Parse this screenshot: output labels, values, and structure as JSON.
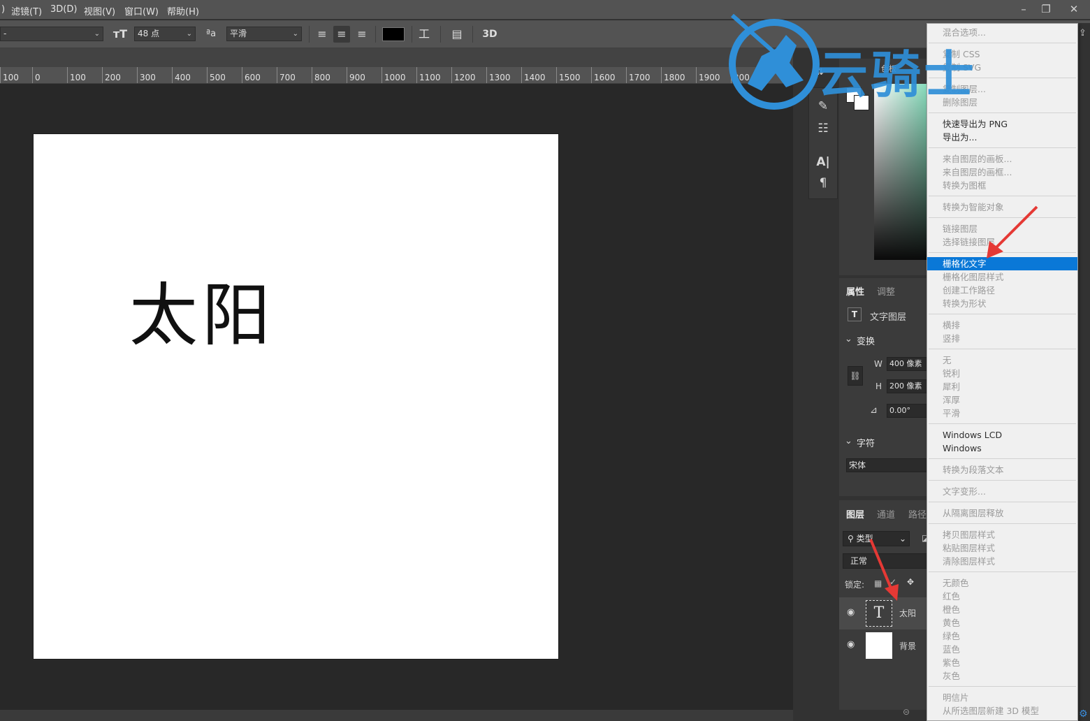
{
  "menubar": {
    "items": [
      "滤镜(T)",
      "3D(D)",
      "视图(V)",
      "窗口(W)",
      "帮助(H)"
    ],
    "left_fragment": ")",
    "window_buttons": [
      "minimize-icon",
      "restore-icon",
      "close-icon"
    ]
  },
  "optionsbar": {
    "font_style": "-",
    "size": "48 点",
    "antialias": "平滑",
    "three_d": "3D"
  },
  "ruler": {
    "labels": [
      "100",
      "0",
      "100",
      "200",
      "300",
      "400",
      "500",
      "600",
      "700",
      "800",
      "900",
      "1000",
      "1100",
      "1200",
      "1300",
      "1400",
      "1500",
      "1600",
      "1700",
      "1800",
      "1900",
      "200"
    ]
  },
  "document": {
    "text": "太阳",
    "background_color": "#ffffff"
  },
  "properties": {
    "tab_active": "属性",
    "tab_other": "调整",
    "layer_type": "文字图层",
    "transform_header": "变换",
    "w_label": "W",
    "w_value": "400 像素",
    "h_label": "H",
    "h_value": "200 像素",
    "angle_value": "0.00°",
    "char_header": "字符",
    "font_family": "宋体"
  },
  "layers": {
    "tabs": [
      "图层",
      "通道",
      "路径"
    ],
    "filter": "类型",
    "blend": "正常",
    "lock_label": "锁定:",
    "rows": [
      {
        "name": "太阳",
        "kind": "text"
      },
      {
        "name": "背景",
        "kind": "image"
      }
    ]
  },
  "color_panel": {
    "tab_fragment": "色板"
  },
  "context_menu": {
    "groups": [
      [
        {
          "label": "混合选项...",
          "enabled": false
        }
      ],
      [
        {
          "label": "复制 CSS",
          "enabled": false
        },
        {
          "label": "复制 SVG",
          "enabled": false
        }
      ],
      [
        {
          "label": "复制图层...",
          "enabled": false
        },
        {
          "label": "删除图层",
          "enabled": false
        }
      ],
      [
        {
          "label": "快速导出为 PNG",
          "enabled": true
        },
        {
          "label": "导出为...",
          "enabled": true
        }
      ],
      [
        {
          "label": "来自图层的画板...",
          "enabled": false
        },
        {
          "label": "来自图层的画框...",
          "enabled": false
        },
        {
          "label": "转换为图框",
          "enabled": false
        }
      ],
      [
        {
          "label": "转换为智能对象",
          "enabled": false
        }
      ],
      [
        {
          "label": "链接图层",
          "enabled": false
        },
        {
          "label": "选择链接图层",
          "enabled": false
        }
      ],
      [
        {
          "label": "栅格化文字",
          "enabled": true,
          "highlighted": true
        },
        {
          "label": "栅格化图层样式",
          "enabled": false
        },
        {
          "label": "创建工作路径",
          "enabled": false
        },
        {
          "label": "转换为形状",
          "enabled": false
        }
      ],
      [
        {
          "label": "横排",
          "enabled": false
        },
        {
          "label": "竖排",
          "enabled": false
        }
      ],
      [
        {
          "label": "无",
          "enabled": false
        },
        {
          "label": "锐利",
          "enabled": false
        },
        {
          "label": "犀利",
          "enabled": false
        },
        {
          "label": "浑厚",
          "enabled": false
        },
        {
          "label": "平滑",
          "enabled": false
        }
      ],
      [
        {
          "label": "Windows LCD",
          "enabled": true
        },
        {
          "label": "Windows",
          "enabled": true
        }
      ],
      [
        {
          "label": "转换为段落文本",
          "enabled": false
        }
      ],
      [
        {
          "label": "文字变形...",
          "enabled": false
        }
      ],
      [
        {
          "label": "从隔离图层释放",
          "enabled": false
        }
      ],
      [
        {
          "label": "拷贝图层样式",
          "enabled": false
        },
        {
          "label": "粘贴图层样式",
          "enabled": false
        },
        {
          "label": "清除图层样式",
          "enabled": false
        }
      ],
      [
        {
          "label": "无颜色",
          "enabled": false
        },
        {
          "label": "红色",
          "enabled": false
        },
        {
          "label": "橙色",
          "enabled": false
        },
        {
          "label": "黄色",
          "enabled": false
        },
        {
          "label": "绿色",
          "enabled": false
        },
        {
          "label": "蓝色",
          "enabled": false
        },
        {
          "label": "紫色",
          "enabled": false
        },
        {
          "label": "灰色",
          "enabled": false
        }
      ],
      [
        {
          "label": "明信片",
          "enabled": false
        },
        {
          "label": "从所选图层新建 3D 模型",
          "enabled": false
        }
      ]
    ]
  },
  "watermark": {
    "text": "云骑士"
  },
  "colors": {
    "highlight": "#0a78d7",
    "arrow": "#e53935",
    "watermark": "#2f8fd8"
  }
}
